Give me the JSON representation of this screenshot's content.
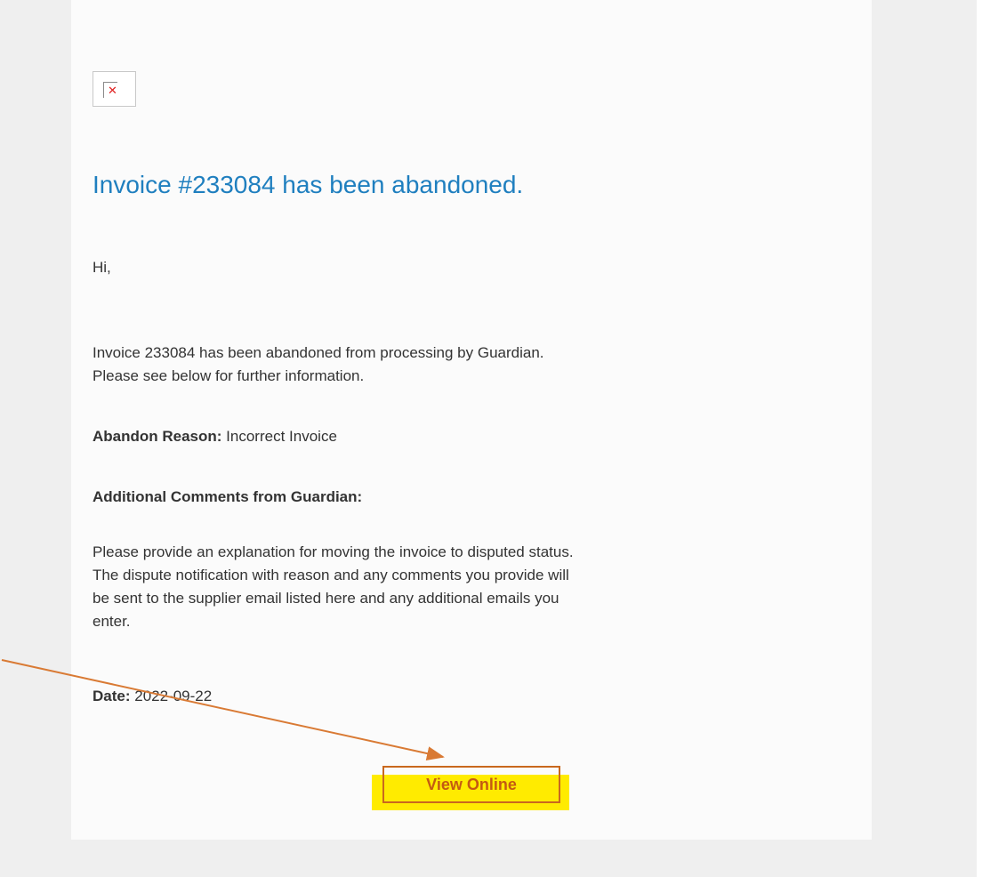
{
  "email": {
    "headline": "Invoice #233084 has been abandoned.",
    "greeting": "Hi,",
    "intro_line1": "Invoice 233084 has been abandoned from processing by Guardian.",
    "intro_line2": "Please see below for further information.",
    "abandon_reason_label": "Abandon Reason:",
    "abandon_reason_value": " Incorrect Invoice",
    "comments_label": "Additional Comments from Guardian:",
    "comments_lines": [
      "Please provide an explanation for moving the invoice to disputed status.",
      "The dispute notification with reason and any comments you provide will",
      "be sent to the supplier email listed here and any additional emails you",
      "enter."
    ],
    "date_label": "Date:",
    "date_value": " 2022-09-22",
    "view_online_label": "View Online",
    "broken_image_icon": "broken-image-icon"
  },
  "annotations": {
    "arrow_color": "#d97a34",
    "highlight_color": "#ffeb00",
    "box_color": "#c9681e"
  }
}
